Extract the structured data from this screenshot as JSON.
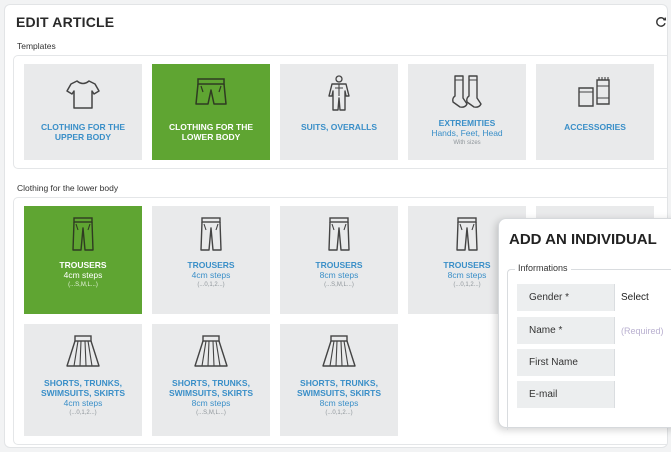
{
  "page": {
    "title": "EDIT ARTICLE"
  },
  "templates": {
    "label": "Templates",
    "items": [
      {
        "line1": "CLOTHING FOR THE UPPER BODY",
        "line2": "",
        "line3": "",
        "icon": "tshirt-icon"
      },
      {
        "line1": "CLOTHING FOR THE LOWER BODY",
        "line2": "",
        "line3": "",
        "icon": "shorts-icon",
        "active": true
      },
      {
        "line1": "SUITS, OVERALLS",
        "line2": "",
        "line3": "",
        "icon": "overalls-icon"
      },
      {
        "line1": "EXTREMITIES",
        "line2": "Hands, Feet, Head",
        "line3": "With sizes",
        "icon": "socks-icon"
      },
      {
        "line1": "ACCESSORIES",
        "line2": "",
        "line3": "",
        "icon": "accessories-icon"
      }
    ]
  },
  "lower_body": {
    "label": "Clothing for the lower body",
    "items": [
      {
        "line1": "TROUSERS",
        "line2": "4cm steps",
        "line3": "(...S,M,L...)",
        "icon": "trousers-icon",
        "active": true
      },
      {
        "line1": "TROUSERS",
        "line2": "4cm steps",
        "line3": "(...0,1,2...)",
        "icon": "trousers-icon"
      },
      {
        "line1": "TROUSERS",
        "line2": "8cm steps",
        "line3": "(...S,M,L...)",
        "icon": "trousers-icon"
      },
      {
        "line1": "TROUSERS",
        "line2": "8cm steps",
        "line3": "(...0,1,2...)",
        "icon": "trousers-icon"
      },
      {
        "line1": "SHORTS, TRUNKS, SWIMSUITS, SKIRTS",
        "line2": "4cm steps",
        "line3": "(...0,1,2...)",
        "icon": "skirt-icon"
      },
      {
        "line1": "SHORTS, TRUNKS, SWIMSUITS, SKIRTS",
        "line2": "8cm steps",
        "line3": "(...S,M,L...)",
        "icon": "skirt-icon"
      },
      {
        "line1": "SHORTS, TRUNKS, SWIMSUITS, SKIRTS",
        "line2": "8cm steps",
        "line3": "(...0,1,2...)",
        "icon": "skirt-icon"
      }
    ]
  },
  "dialog": {
    "title": "ADD AN INDIVIDUAL",
    "section": "Informations",
    "fields": [
      {
        "label": "Gender *",
        "value": "Select",
        "placeholder": ""
      },
      {
        "label": "Name *",
        "value": "",
        "placeholder": "(Required)"
      },
      {
        "label": "First Name",
        "value": "",
        "placeholder": ""
      },
      {
        "label": "E-mail",
        "value": "",
        "placeholder": ""
      }
    ]
  },
  "colors": {
    "accent_green": "#5fa532",
    "link_blue": "#3a8fc8",
    "tile_gray": "#e9eaeb"
  }
}
